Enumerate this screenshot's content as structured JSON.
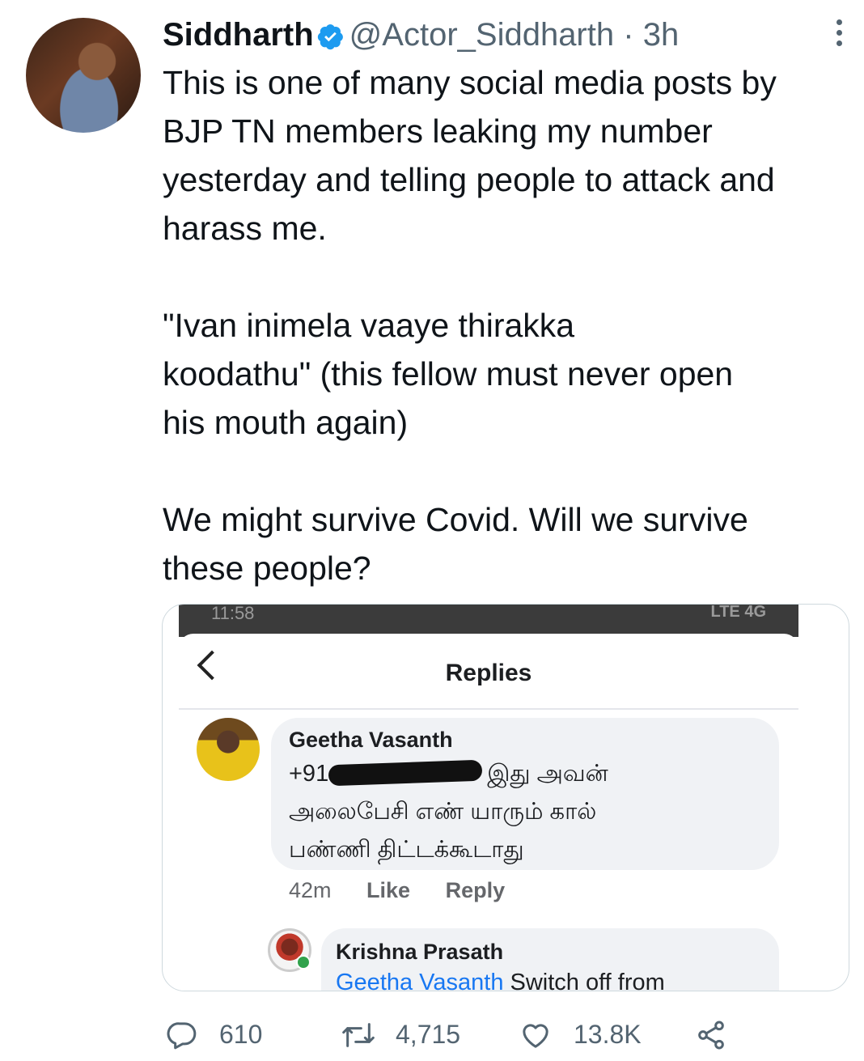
{
  "tweet": {
    "author": "Siddharth",
    "handle": "@Actor_Siddharth",
    "separator": "·",
    "time": "3h",
    "text": "This is one of many social media posts by\nBJP TN members leaking my number\nyesterday and telling people to attack and\nharass me.\n\n\"Ivan inimela vaaye thirakka\nkoodathu\" (this fellow must never open\nhis mouth again)\n\nWe might survive Covid. Will we survive\nthese people?"
  },
  "media": {
    "status_time": "11:58",
    "status_network": "LTE  4G",
    "title": "Replies",
    "comment1": {
      "author": "Geetha Vasanth",
      "prefix": "+91",
      "line1_rest": "இது அவன்",
      "line2": "அலைபேசி எண் யாரும் கால்",
      "line3": "பண்ணி திட்டக்கூடாது",
      "age": "42m",
      "like": "Like",
      "reply": "Reply"
    },
    "comment2": {
      "author": "Krishna Prasath",
      "mention": "Geetha Vasanth",
      "text": " Switch off from"
    }
  },
  "stats": {
    "replies": "610",
    "retweets": "4,715",
    "likes": "13.8K"
  },
  "colors": {
    "verified": "#1d9bf0",
    "secondary_text": "#536471",
    "facebook_link": "#1877f2"
  }
}
